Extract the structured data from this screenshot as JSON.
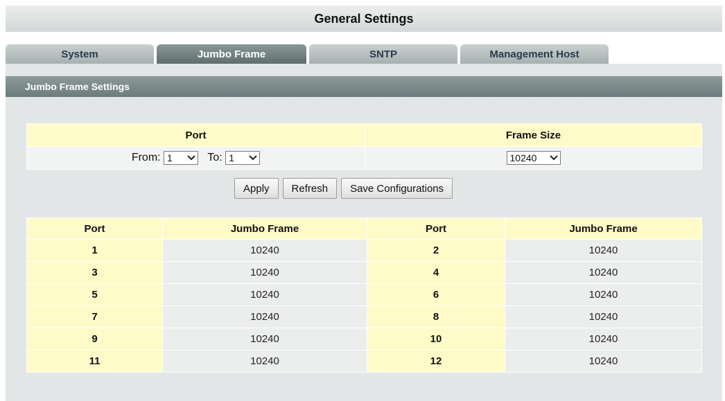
{
  "title": "General Settings",
  "tabs": [
    {
      "label": "System",
      "active": false
    },
    {
      "label": "Jumbo Frame",
      "active": true
    },
    {
      "label": "SNTP",
      "active": false
    },
    {
      "label": "Management Host",
      "active": false
    }
  ],
  "section_header": "Jumbo Frame Settings",
  "config": {
    "port_header": "Port",
    "frame_size_header": "Frame Size",
    "from_label": "From:",
    "from_value": "1",
    "to_label": "To:",
    "to_value": "1",
    "frame_size_value": "10240"
  },
  "buttons": {
    "apply": "Apply",
    "refresh": "Refresh",
    "save": "Save Configurations"
  },
  "status_table": {
    "headers": [
      "Port",
      "Jumbo Frame",
      "Port",
      "Jumbo Frame"
    ],
    "rows": [
      [
        "1",
        "10240",
        "2",
        "10240"
      ],
      [
        "3",
        "10240",
        "4",
        "10240"
      ],
      [
        "5",
        "10240",
        "6",
        "10240"
      ],
      [
        "7",
        "10240",
        "8",
        "10240"
      ],
      [
        "9",
        "10240",
        "10",
        "10240"
      ],
      [
        "11",
        "10240",
        "12",
        "10240"
      ]
    ]
  },
  "colors": {
    "header_yellow": "#fffbc9",
    "active_tab": "#6c7b7b",
    "panel_bg": "#e3e6e6"
  }
}
